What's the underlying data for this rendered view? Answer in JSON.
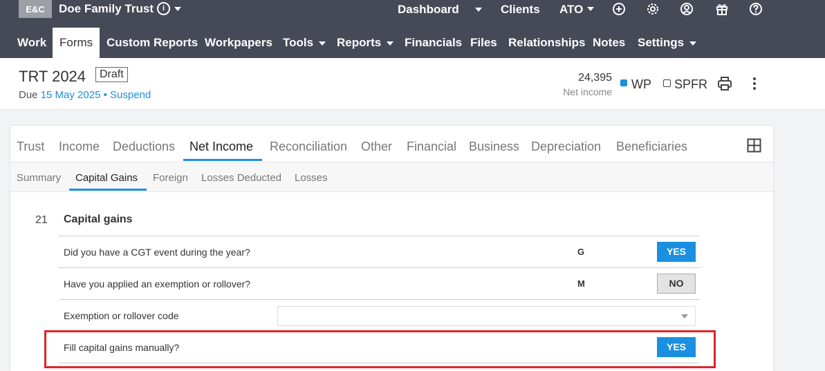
{
  "app": {
    "logo": "E&C",
    "client_name": "Doe Family Trust",
    "info_icon": "i",
    "top_links": [
      "Dashboard",
      "Clients",
      "ATO"
    ],
    "top_icons": [
      "add-circle-icon",
      "gear-icon",
      "user-icon",
      "gift-icon",
      "help-icon"
    ]
  },
  "nav": {
    "items": [
      {
        "label": "Work"
      },
      {
        "label": "Forms",
        "active": true
      },
      {
        "label": "Custom Reports"
      },
      {
        "label": "Workpapers"
      },
      {
        "label": "Tools"
      },
      {
        "label": "Reports"
      },
      {
        "label": "Financials"
      },
      {
        "label": "Files"
      },
      {
        "label": "Relationships"
      },
      {
        "label": "Notes"
      },
      {
        "label": "Settings"
      }
    ]
  },
  "doc": {
    "title": "TRT 2024",
    "badge": "Draft",
    "due_prefix": "Due",
    "due_date": "15 May 2025",
    "separator": "•",
    "suspend": "Suspend",
    "net_income_value": "24,395",
    "net_income_label": "Net income",
    "wp_label": "WP",
    "spfr_label": "SPFR",
    "wp_checked": true,
    "spfr_checked": false
  },
  "tabs": {
    "items": [
      "Trust",
      "Income",
      "Deductions",
      "Net Income",
      "Reconciliation",
      "Other",
      "Financial",
      "Business",
      "Depreciation",
      "Beneficiaries"
    ],
    "active": "Net Income"
  },
  "subtabs": {
    "items": [
      "Summary",
      "Capital Gains",
      "Foreign",
      "Losses Deducted",
      "Losses"
    ],
    "active": "Capital Gains"
  },
  "section": {
    "number": "21",
    "title": "Capital gains",
    "rows": [
      {
        "label": "Did you have a CGT event during the year?",
        "code": "G",
        "answer": "YES"
      },
      {
        "label": "Have you applied an exemption or rollover?",
        "code": "M",
        "answer": "NO"
      },
      {
        "label": "Exemption or rollover code",
        "code": "",
        "answer": ""
      },
      {
        "label": "Fill capital gains manually?",
        "code": "",
        "answer": "YES"
      }
    ]
  },
  "colors": {
    "topbar": "#464a57",
    "accent": "#1b8fe0",
    "highlight": "#e0242a"
  }
}
